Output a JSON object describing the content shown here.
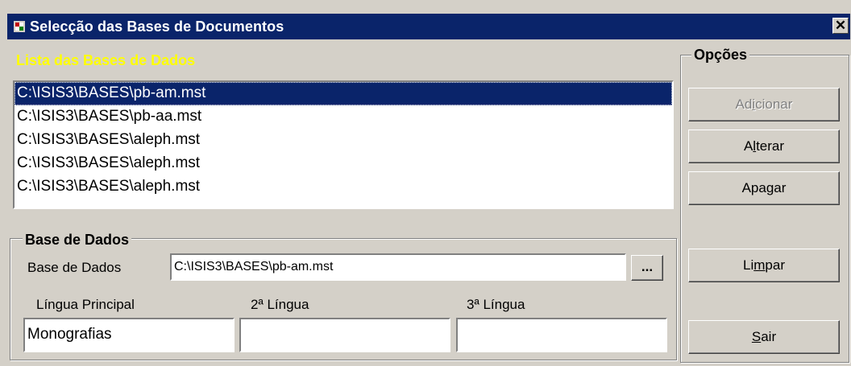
{
  "window": {
    "title": "Selecção das Bases de Documentos",
    "close_label": "✕"
  },
  "list": {
    "header": "Lista das Bases de Dados",
    "items": [
      "C:\\ISIS3\\BASES\\pb-am.mst",
      "C:\\ISIS3\\BASES\\pb-aa.mst",
      "C:\\ISIS3\\BASES\\aleph.mst",
      "C:\\ISIS3\\BASES\\aleph.mst",
      "C:\\ISIS3\\BASES\\aleph.mst"
    ],
    "selected_index": 0
  },
  "database_group": {
    "title": "Base de Dados",
    "database_label": "Base de Dados",
    "database_value": "C:\\ISIS3\\BASES\\pb-am.mst",
    "browse_label": "...",
    "main_language_label": "Língua Principal",
    "main_language_value": "Monografias",
    "second_language_label": "2ª Língua",
    "second_language_value": "",
    "third_language_label": "3ª Língua",
    "third_language_value": ""
  },
  "options": {
    "title": "Opções",
    "add": {
      "pre": "Ad",
      "key": "i",
      "post": "cionar",
      "disabled": true
    },
    "change": {
      "pre": "A",
      "key": "l",
      "post": "terar"
    },
    "delete": {
      "pre": "Apa",
      "key": "g",
      "post": "ar"
    },
    "clear": {
      "pre": "Li",
      "key": "m",
      "post": "par"
    },
    "exit": {
      "pre": "",
      "key": "S",
      "post": "air"
    }
  },
  "colors": {
    "titlebar": "#0a246a",
    "selection": "#0a246a",
    "list_header": "#ffff00",
    "face": "#d4d0c8"
  }
}
